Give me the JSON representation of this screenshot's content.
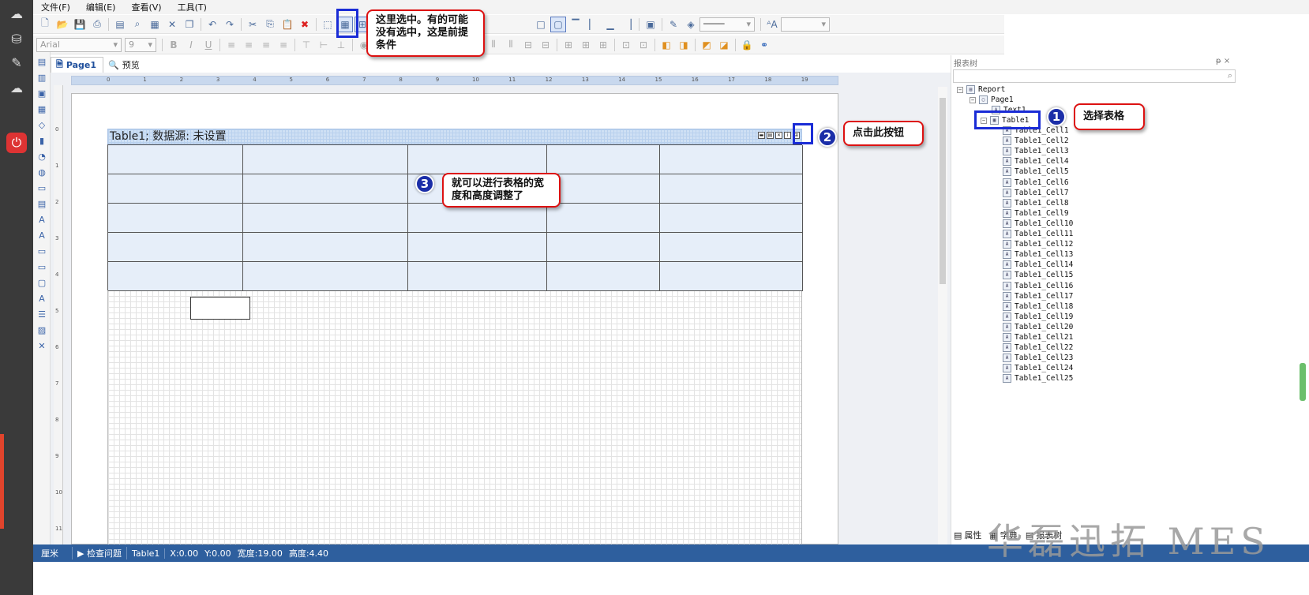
{
  "menu": [
    "文件(F)",
    "编辑(E)",
    "查看(V)",
    "工具(T)"
  ],
  "toolbar2": {
    "font": "Arial",
    "size": "9"
  },
  "tabs": [
    {
      "label": "Page1",
      "active": true
    },
    {
      "label": "预览",
      "active": false
    }
  ],
  "ruler": {
    "h": [
      "0",
      "1",
      "2",
      "3",
      "4",
      "5",
      "6",
      "7",
      "8",
      "9",
      "10",
      "11",
      "12",
      "13",
      "14",
      "15",
      "16",
      "17",
      "18",
      "19"
    ],
    "v": [
      "0",
      "1",
      "2",
      "3",
      "4",
      "5",
      "6",
      "7",
      "8",
      "9",
      "10",
      "11"
    ]
  },
  "table": {
    "header": "Table1; 数据源: 未设置",
    "rows": 5,
    "cols": 5
  },
  "tree_panel": {
    "title": "报表树",
    "pin": "ᵽ ×",
    "root": "Report",
    "page": "Page1",
    "text": "Text1",
    "table": "Table1",
    "cells": [
      "Table1_Cell1",
      "Table1_Cell2",
      "Table1_Cell3",
      "Table1_Cell4",
      "Table1_Cell5",
      "Table1_Cell6",
      "Table1_Cell7",
      "Table1_Cell8",
      "Table1_Cell9",
      "Table1_Cell10",
      "Table1_Cell11",
      "Table1_Cell12",
      "Table1_Cell13",
      "Table1_Cell14",
      "Table1_Cell15",
      "Table1_Cell16",
      "Table1_Cell17",
      "Table1_Cell18",
      "Table1_Cell19",
      "Table1_Cell20",
      "Table1_Cell21",
      "Table1_Cell22",
      "Table1_Cell23",
      "Table1_Cell24",
      "Table1_Cell25"
    ],
    "bottom_tabs": [
      "属性",
      "字典",
      "报表树"
    ]
  },
  "status": {
    "unit": "厘米",
    "check": "检查问题",
    "object": "Table1",
    "x": "X:0.00",
    "y": "Y:0.00",
    "width": "宽度:19.00",
    "height": "高度:4.40"
  },
  "callouts": {
    "c0": "这里选中。有的可能没有选中，这是前提条件",
    "c1": "选择表格",
    "c2": "点击此按钮",
    "c3": "就可以进行表格的宽度和高度调整了",
    "n1": "1",
    "n2": "2",
    "n3": "3"
  },
  "watermark": "华磊迅拓 MES",
  "colors": {
    "status_bar": "#2e5f9e",
    "callout_border": "#dd1111",
    "highlight": "#1a2cd6"
  }
}
